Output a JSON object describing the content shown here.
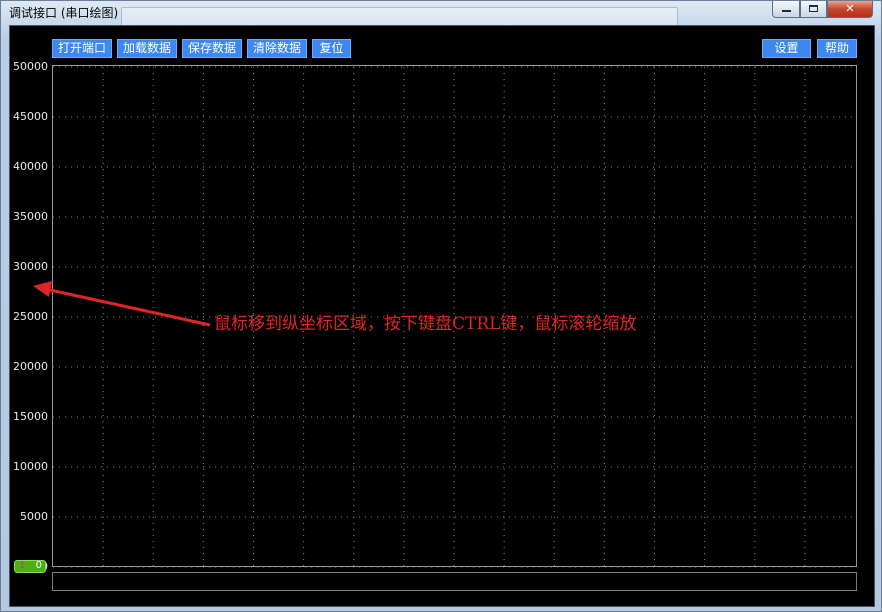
{
  "window": {
    "title": "调试接口 (串口绘图)",
    "controls": {
      "minimize": "—",
      "maximize": "□",
      "close": "✕"
    }
  },
  "toolbar": {
    "open_port": "打开端口",
    "load_data": "加载数据",
    "save_data": "保存数据",
    "clear_data": "清除数据",
    "reset": "复位",
    "settings": "设置",
    "help": "帮助"
  },
  "plot": {
    "y_ticks": [
      "50000",
      "45000",
      "40000",
      "35000",
      "30000",
      "25000",
      "20000",
      "15000",
      "10000",
      "5000",
      "0"
    ],
    "ylim": [
      0,
      50000
    ],
    "grid": "dotted",
    "annotation": "鼠标移到纵坐标区域，按下键盘CTRL键，鼠标滚轮缩放"
  },
  "channel": {
    "id": "1",
    "value": "0",
    "color": "#4caf14"
  },
  "colors": {
    "button": "#3c87f0",
    "annotation": "#e02525",
    "background": "#000000"
  }
}
